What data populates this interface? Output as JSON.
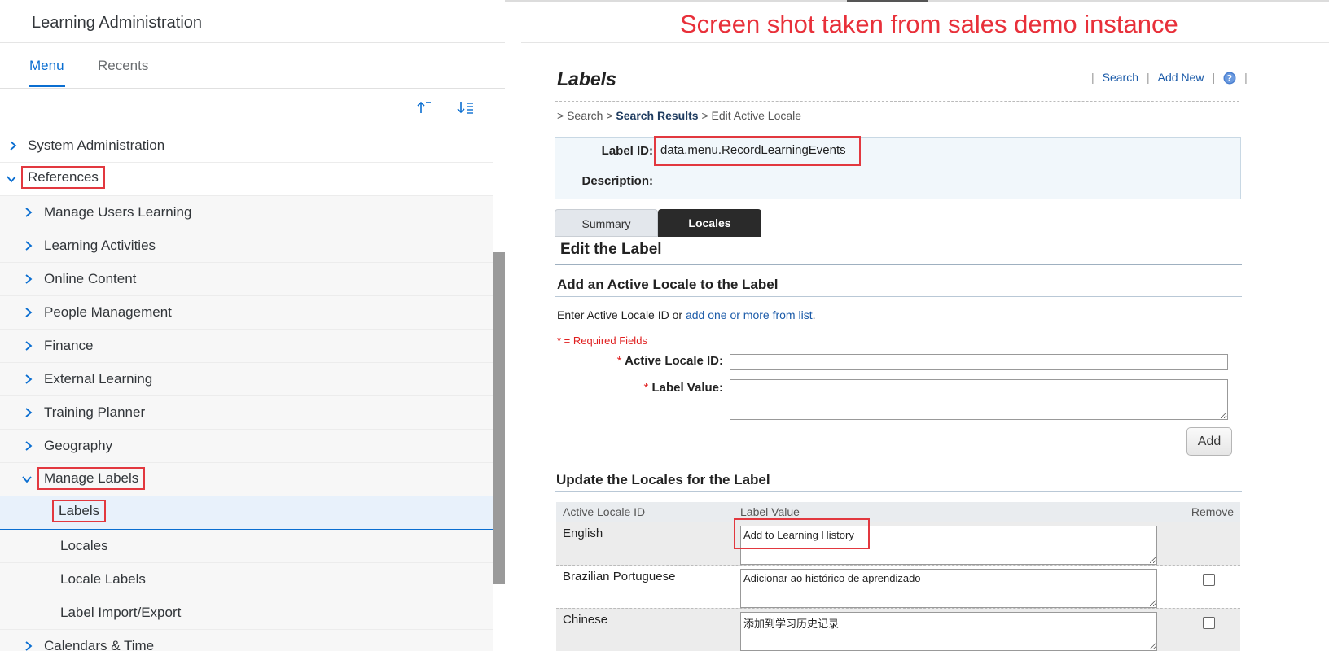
{
  "left_pane": {
    "app_title": "Learning Administration",
    "tabs": [
      {
        "label": "Menu",
        "active": true
      },
      {
        "label": "Recents",
        "active": false
      }
    ],
    "toolbar_icons": [
      "sort-ascending-icon",
      "sort-list-icon"
    ],
    "tree": [
      {
        "label": "System Administration",
        "expanded": false,
        "level": 0
      },
      {
        "label": "References",
        "expanded": true,
        "level": 0
      },
      {
        "label": "Manage Users Learning",
        "expanded": false,
        "level": 1
      },
      {
        "label": "Learning Activities",
        "expanded": false,
        "level": 1
      },
      {
        "label": "Online Content",
        "expanded": false,
        "level": 1
      },
      {
        "label": "People Management",
        "expanded": false,
        "level": 1
      },
      {
        "label": "Finance",
        "expanded": false,
        "level": 1
      },
      {
        "label": "External Learning",
        "expanded": false,
        "level": 1
      },
      {
        "label": "Training Planner",
        "expanded": false,
        "level": 1
      },
      {
        "label": "Geography",
        "expanded": false,
        "level": 1
      },
      {
        "label": "Manage Labels",
        "expanded": true,
        "level": 1
      },
      {
        "label": "Labels",
        "selected": true,
        "level": 2
      },
      {
        "label": "Locales",
        "level": 2
      },
      {
        "label": "Locale Labels",
        "level": 2
      },
      {
        "label": "Label Import/Export",
        "level": 2
      },
      {
        "label": "Calendars & Time",
        "expanded": false,
        "level": 1
      }
    ]
  },
  "annotation": {
    "note": "Screen shot taken from sales demo instance",
    "color": "#e8303a"
  },
  "right_pane": {
    "page_title": "Labels",
    "header_links": {
      "search": "Search",
      "add_new": "Add New",
      "separator": "|"
    },
    "breadcrumb": {
      "prefix": "> ",
      "search": "Search",
      "sep": " > ",
      "results": "Search Results",
      "current": "Edit Active Locale"
    },
    "info": {
      "label_id_label": "Label ID:",
      "label_id_value": "data.menu.RecordLearningEvents",
      "description_label": "Description:"
    },
    "tabs": [
      {
        "label": "Summary",
        "active": false
      },
      {
        "label": "Locales",
        "active": true
      }
    ],
    "edit_title": "Edit the Label",
    "add_section": {
      "title": "Add an Active Locale to the Label",
      "hint_prefix": "Enter Active Locale ID or ",
      "hint_link": "add one or more from list",
      "hint_suffix": ".",
      "required_note": "* = Required Fields",
      "active_locale_label": "Active Locale ID:",
      "label_value_label": "Label Value:",
      "required_mark": "*",
      "active_locale_value": "",
      "label_value_value": "",
      "add_button": "Add"
    },
    "update_section": {
      "title": "Update the Locales for the Label",
      "columns": [
        "Active Locale ID",
        "Label Value",
        "Remove"
      ],
      "rows": [
        {
          "locale": "English",
          "value": "Add to Learning History",
          "removable": false
        },
        {
          "locale": "Brazilian Portuguese",
          "value": "Adicionar ao histórico de aprendizado",
          "removable": true
        },
        {
          "locale": "Chinese",
          "value": "添加到学习历史记录",
          "removable": true
        }
      ]
    }
  },
  "colors": {
    "accent": "#0a6ed1",
    "highlight": "#e2383f",
    "active_tab": "#2a2a2a"
  }
}
